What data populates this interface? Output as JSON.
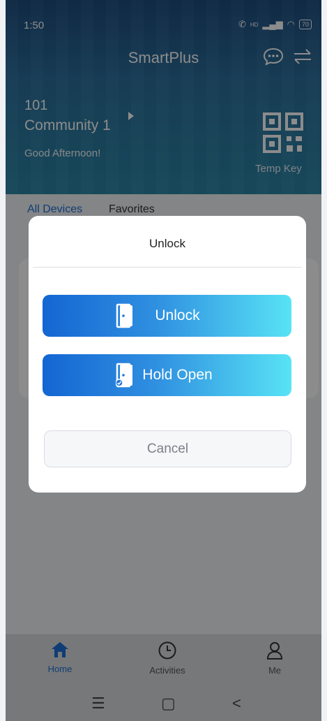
{
  "status_bar": {
    "time": "1:50",
    "battery": "70",
    "signal": "HD"
  },
  "header": {
    "title": "SmartPlus",
    "unit": "101",
    "community": "Community 1",
    "greeting": "Good Afternoon!",
    "temp_key_label": "Temp Key"
  },
  "tabs": [
    {
      "label": "All Devices",
      "active": true
    },
    {
      "label": "Favorites",
      "active": false
    }
  ],
  "modal": {
    "title": "Unlock",
    "unlock_label": "Unlock",
    "hold_open_label": "Hold Open",
    "cancel_label": "Cancel"
  },
  "bottom_nav": [
    {
      "label": "Home",
      "icon": "home-icon",
      "active": true
    },
    {
      "label": "Activities",
      "icon": "clock-icon",
      "active": false
    },
    {
      "label": "Me",
      "icon": "person-icon",
      "active": false
    }
  ],
  "system_nav": {
    "menu": "☰",
    "home": "▢",
    "back": "<"
  },
  "colors": {
    "accent": "#1d6fd6",
    "gradient_start": "#1466d2",
    "gradient_end": "#58e3f5"
  }
}
